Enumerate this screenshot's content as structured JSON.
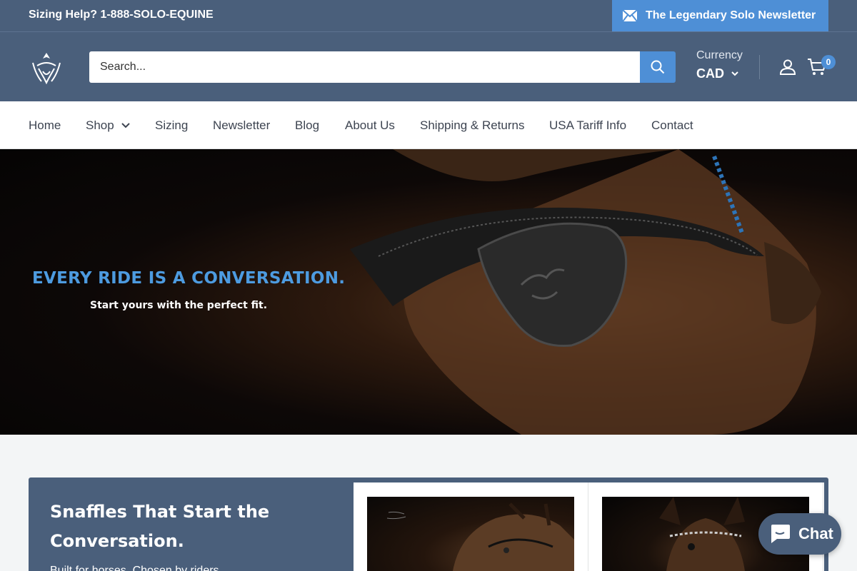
{
  "topbar": {
    "sizing_help": "Sizing Help? 1-888-SOLO-EQUINE",
    "newsletter_label": "The Legendary Solo Newsletter"
  },
  "header": {
    "search_placeholder": "Search...",
    "currency_label": "Currency",
    "currency_value": "CAD",
    "cart_count": "0"
  },
  "nav": {
    "items": [
      "Home",
      "Shop",
      "Sizing",
      "Newsletter",
      "Blog",
      "About Us",
      "Shipping & Returns",
      "USA Tariff Info",
      "Contact"
    ]
  },
  "hero": {
    "headline": "EVERY RIDE IS A CONVERSATION.",
    "subline": "Start yours with the perfect fit."
  },
  "promo": {
    "title": "Snaffles That Start the Conversation.",
    "description": "Built for horses. Chosen by riders."
  },
  "chat": {
    "label": "Chat"
  },
  "colors": {
    "header_bg": "#4a5f7b",
    "accent": "#4e8fd6"
  }
}
